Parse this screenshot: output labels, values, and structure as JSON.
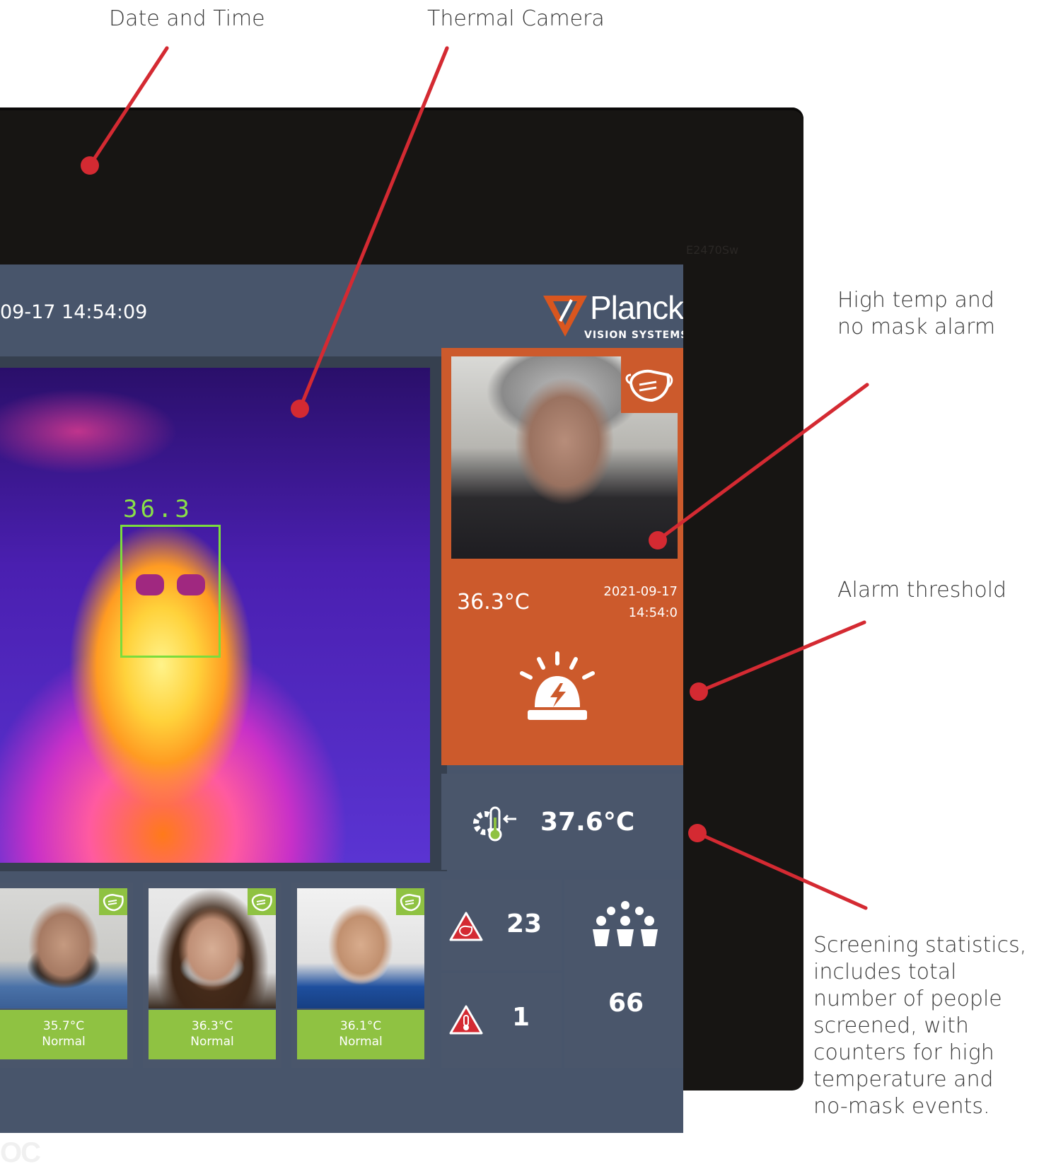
{
  "callouts": {
    "date_time": "Date and Time",
    "thermal_camera": "Thermal Camera",
    "alarm_line1": "High temp and",
    "alarm_line2": "no mask alarm",
    "threshold": "Alarm threshold",
    "stats_lines": [
      "Screening statistics,",
      "includes total",
      "number of people",
      "screened, with",
      "counters for high",
      "temperature and",
      "no-mask events."
    ]
  },
  "monitor": {
    "model": "E2470Sw",
    "brand": "OC"
  },
  "header": {
    "datetime": "09-17 14:54:09",
    "logo_name": "Planck",
    "logo_sub": "VISION SYSTEMS"
  },
  "thermal": {
    "face_temp": "36.3"
  },
  "alarm": {
    "temperature": "36.3°C",
    "date": "2021-09-17",
    "time": "14:54:0"
  },
  "threshold": {
    "value": "37.6°C"
  },
  "recent": [
    {
      "temp": "35.7°C",
      "status": "Normal"
    },
    {
      "temp": "36.3°C",
      "status": "Normal"
    },
    {
      "temp": "36.1°C",
      "status": "Normal"
    }
  ],
  "stats": {
    "no_mask_count": "23",
    "high_temp_count": "1",
    "total_screened": "66"
  },
  "colors": {
    "accent_red": "#d42a32",
    "alarm_orange": "#cc5a2c",
    "normal_green": "#8fc242",
    "panel": "#4a566b",
    "screen_bg": "#48556b"
  }
}
